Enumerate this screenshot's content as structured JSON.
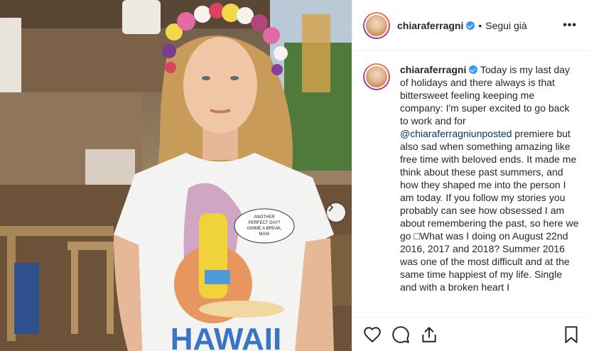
{
  "post": {
    "username": "chiaraferragni",
    "separator": "•",
    "follow_label": "Segui già",
    "more_label": "•••"
  },
  "caption": {
    "username": "chiaraferragni",
    "part1": " Today is my last day of holidays and there always is that bittersweet feeling keeping me company: I'm super excited to go back to work and for ",
    "mention": "@chiaraferragniunposted",
    "part2": " premiere but also sad when something amazing like free time with beloved ends. It made me think about these past summers, and how they shaped me into the person I am today. If you follow my stories you probably can see how obsessed I am about remembering the past, so here we go □What was I doing on August 22nd 2016, 2017 and 2018? Summer 2016 was one of the most difficult and at the same time happiest of my life. Single and with a broken heart I"
  },
  "photo": {
    "shirt_text": "HAWAII",
    "bubble_line1": "ANOTHER",
    "bubble_line2": "PERFECT DAY?",
    "bubble_line3": "GIMME A BREAK,",
    "bubble_line4": "MAN!"
  },
  "icons": {
    "verified": "verified-badge-icon",
    "like": "heart-icon",
    "comment": "comment-bubble-icon",
    "share": "share-icon",
    "save": "bookmark-icon",
    "next": "chevron-right-icon"
  },
  "colors": {
    "verified_blue": "#3897f0",
    "mention": "#003569",
    "text": "#262626",
    "border": "#efefef"
  }
}
